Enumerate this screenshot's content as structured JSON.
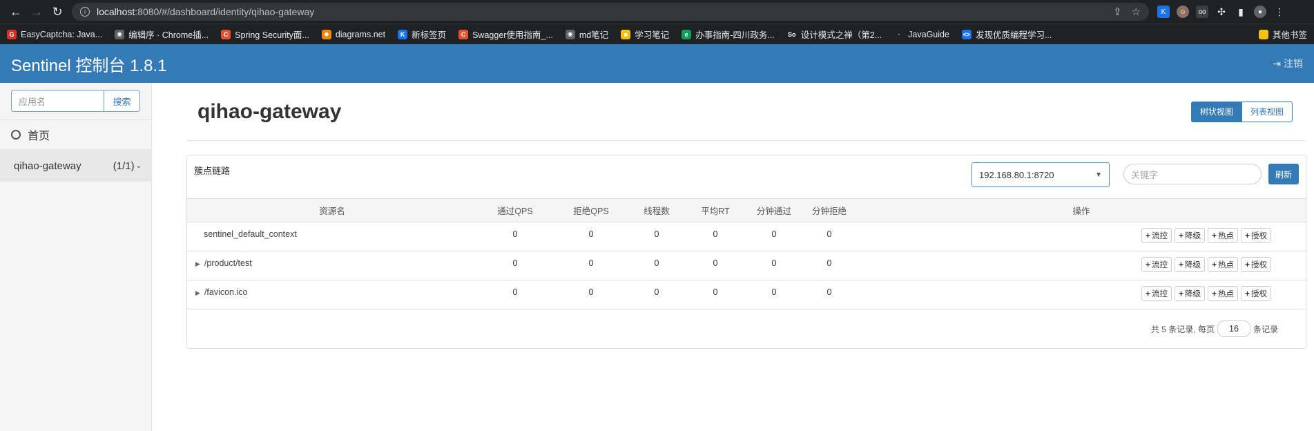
{
  "browser": {
    "url_host": "localhost",
    "url_rest": ":8080/#/dashboard/identity/qihao-gateway",
    "bookmarks": [
      {
        "label": "EasyCaptcha: Java...",
        "icon": "G",
        "color": "#d93025"
      },
      {
        "label": "编辑序 · Chrome插...",
        "icon": "◉",
        "color": "#5f6368"
      },
      {
        "label": "Spring Security面...",
        "icon": "C",
        "color": "#e4512c"
      },
      {
        "label": "diagrams.net",
        "icon": "◆",
        "color": "#f08705"
      },
      {
        "label": "新标签页",
        "icon": "K",
        "color": "#1a73e8"
      },
      {
        "label": "Swagger使用指南_...",
        "icon": "C",
        "color": "#e4512c"
      },
      {
        "label": "md笔记",
        "icon": "◉",
        "color": "#5f6368"
      },
      {
        "label": "学习笔记",
        "icon": "■",
        "color": "#f4c20d"
      },
      {
        "label": "办事指南-四川政务...",
        "icon": "e",
        "color": "#0f9d58"
      },
      {
        "label": "设计模式之禅（第2...",
        "icon": "So",
        "color": "#202124"
      },
      {
        "label": "JavaGuide",
        "icon": "·",
        "color": "#202124"
      },
      {
        "label": "发现优质编程学习...",
        "icon": "<>",
        "color": "#1a73e8"
      }
    ],
    "other_bookmarks": "其他书签"
  },
  "header": {
    "title": "Sentinel 控制台 1.8.1",
    "logout": "注销"
  },
  "sidebar": {
    "search_placeholder": "应用名",
    "search_button": "搜索",
    "home": "首页",
    "app_name": "qihao-gateway",
    "app_count": "(1/1)"
  },
  "main": {
    "title": "qihao-gateway",
    "view_tree": "树状视图",
    "view_list": "列表视图",
    "panel_title": "簇点链路",
    "machine": "192.168.80.1:8720",
    "keyword_placeholder": "关键字",
    "refresh": "刷新",
    "columns": [
      "资源名",
      "通过QPS",
      "拒绝QPS",
      "线程数",
      "平均RT",
      "分钟通过",
      "分钟拒绝",
      "操作"
    ],
    "rows": [
      {
        "name": "sentinel_default_context",
        "expandable": false,
        "values": [
          "0",
          "0",
          "0",
          "0",
          "0",
          "0"
        ]
      },
      {
        "name": "/product/test",
        "expandable": true,
        "values": [
          "0",
          "0",
          "0",
          "0",
          "0",
          "0"
        ]
      },
      {
        "name": "/favicon.ico",
        "expandable": true,
        "values": [
          "0",
          "0",
          "0",
          "0",
          "0",
          "0"
        ]
      }
    ],
    "ops": [
      "流控",
      "降级",
      "热点",
      "授权"
    ],
    "pager_prefix": "共 5 条记录, 每页",
    "page_size": "16",
    "pager_suffix": "条记录"
  }
}
